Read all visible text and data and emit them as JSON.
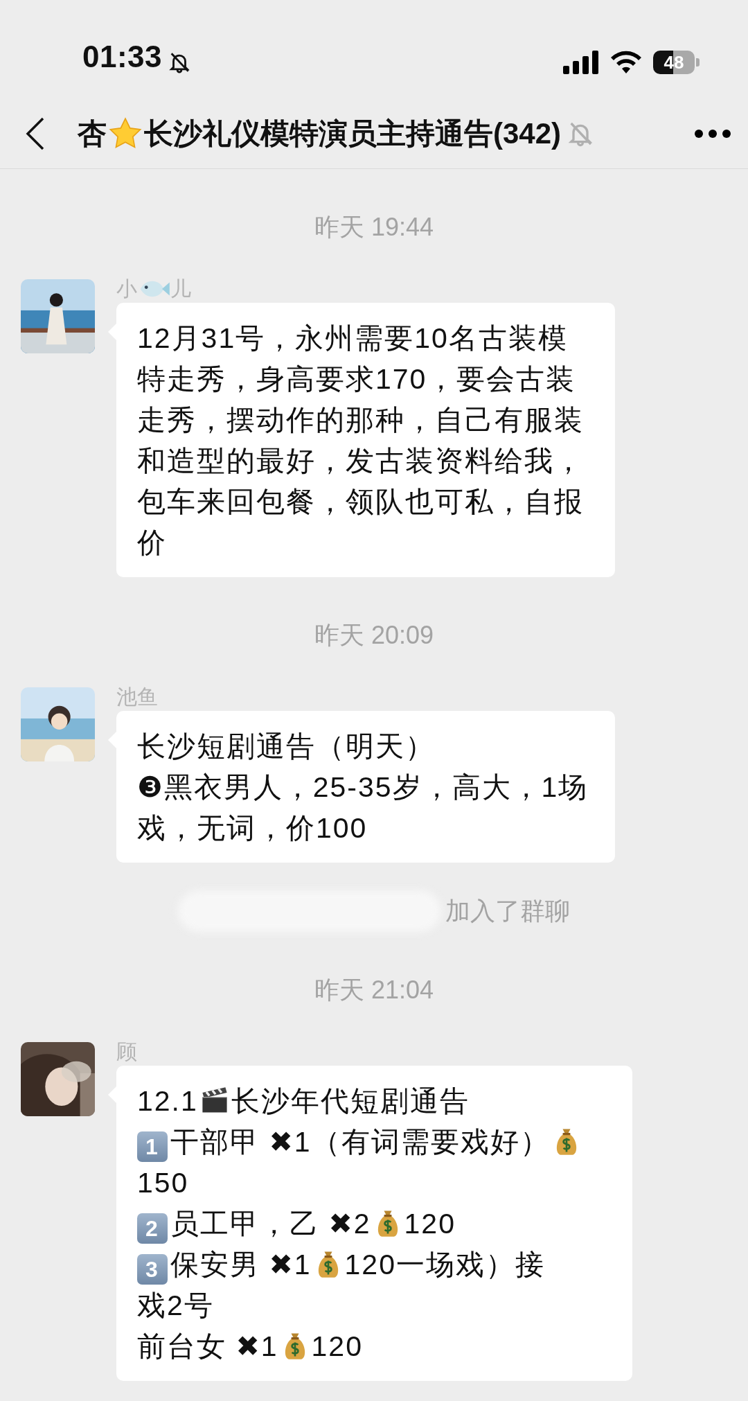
{
  "status_bar": {
    "time": "01:33",
    "muted": true,
    "battery": "48"
  },
  "header": {
    "title_prefix": "杏",
    "title": "长沙礼仪模特演员主持通告",
    "count": "(342)",
    "muted": true
  },
  "chat": [
    {
      "kind": "time",
      "text": "昨天 19:44"
    },
    {
      "kind": "message",
      "name_parts": [
        {
          "kind": "text",
          "text": "小"
        },
        {
          "kind": "fish"
        },
        {
          "kind": "text",
          "text": "儿"
        }
      ],
      "paragraphs": [
        [
          {
            "kind": "text",
            "text": "12月31号，永州需要10名古装模特走秀，身高要求170，要会古装走秀，摆动作的那种，自己有服装和造型的最好，发古装资料给我，包车来回包餐，领队也可私，自报价"
          }
        ]
      ]
    },
    {
      "kind": "time",
      "text": "昨天 20:09"
    },
    {
      "kind": "message",
      "name_parts": [
        {
          "kind": "text",
          "text": "池鱼"
        }
      ],
      "paragraphs": [
        [
          {
            "kind": "text",
            "text": "长沙短剧通告（明天）"
          }
        ],
        [
          {
            "kind": "text",
            "text": "❸黑衣男人，25-35岁，高大，1场戏，无词，价100"
          }
        ]
      ]
    },
    {
      "kind": "system",
      "text": "加入了群聊"
    },
    {
      "kind": "time",
      "text": "昨天 21:04"
    },
    {
      "kind": "message",
      "name_parts": [
        {
          "kind": "text",
          "text": "顾"
        }
      ],
      "paragraphs": [
        [
          {
            "kind": "text",
            "text": "12.1"
          },
          {
            "kind": "clapper"
          },
          {
            "kind": "text",
            "text": "长沙年代短剧通告"
          }
        ],
        [
          {
            "kind": "keycap",
            "text": "1"
          },
          {
            "kind": "text",
            "text": "干部甲 ✖1（有词需要戏好）"
          },
          {
            "kind": "money"
          },
          {
            "kind": "text",
            "text": "150"
          }
        ],
        [
          {
            "kind": "keycap",
            "text": "2"
          },
          {
            "kind": "text",
            "text": "员工甲，乙 ✖2"
          },
          {
            "kind": "money"
          },
          {
            "kind": "text",
            "text": "120"
          }
        ],
        [
          {
            "kind": "keycap",
            "text": "3"
          },
          {
            "kind": "text",
            "text": "保安男 ✖1"
          },
          {
            "kind": "money"
          },
          {
            "kind": "text",
            "text": "120一场戏）接"
          }
        ],
        [
          {
            "kind": "text",
            "text": "戏2号"
          }
        ],
        [
          {
            "kind": "text",
            "text": "前台女 ✖1"
          },
          {
            "kind": "money"
          },
          {
            "kind": "text",
            "text": "120"
          }
        ]
      ]
    }
  ]
}
